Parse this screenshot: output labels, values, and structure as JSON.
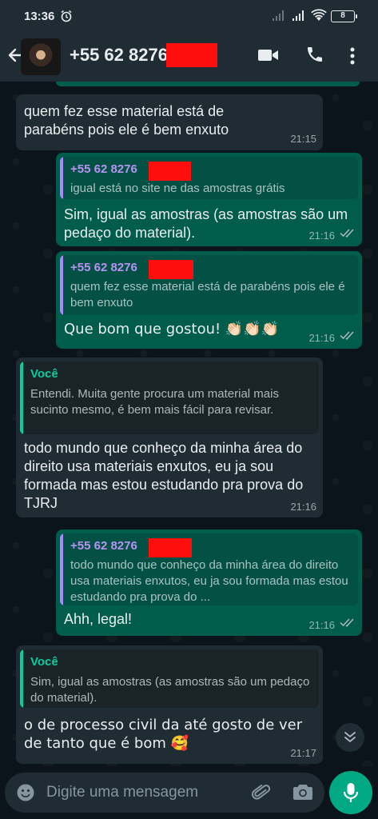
{
  "status_bar": {
    "time": "13:36",
    "battery": "8"
  },
  "header": {
    "contact_name": "+55 62 8276-"
  },
  "messages": [
    {
      "direction": "in",
      "text": "quem fez esse material está de parabéns pois ele é bem enxuto",
      "time": "21:15"
    },
    {
      "direction": "out",
      "quote": {
        "author": "+55 62 8276",
        "text": "igual está no site ne das amostras grátis"
      },
      "text": "Sim, igual as amostras (as amostras são um pedaço do material).",
      "time": "21:16",
      "status": "read"
    },
    {
      "direction": "out",
      "quote": {
        "author": "+55 62 8276",
        "text": "quem fez esse material está de parabéns pois ele é bem enxuto"
      },
      "text": "Que bom que gostou! 👏🏻👏🏻👏🏻",
      "time": "21:16",
      "status": "read"
    },
    {
      "direction": "in",
      "quote": {
        "author": "Você",
        "text": "Entendi. Muita gente procura um material mais sucinto mesmo, é bem mais fácil para revisar."
      },
      "text": "todo mundo que conheço da minha área do direito usa materiais enxutos, eu ja sou formada mas estou estudando pra prova do TJRJ",
      "time": "21:16"
    },
    {
      "direction": "out",
      "quote": {
        "author": "+55 62 8276",
        "text": "todo mundo que conheço da minha área do direito usa materiais enxutos, eu ja sou formada mas estou estudando pra prova do ..."
      },
      "text": "Ahh, legal!",
      "time": "21:16",
      "status": "read"
    },
    {
      "direction": "in",
      "quote": {
        "author": "Você",
        "text": "Sim, igual as amostras (as amostras são um pedaço do material)."
      },
      "text": "o de processo civil da até gosto de ver de tanto que é bom 🥰",
      "time": "21:17"
    }
  ],
  "composer": {
    "placeholder": "Digite uma mensagem"
  },
  "colors": {
    "header": "#1f2c34",
    "outgoing": "#005c4b",
    "incoming": "#202c33",
    "accent": "#00a884",
    "redaction": "#ff0e0e"
  },
  "icons": [
    "alarm-icon",
    "signal-icon",
    "wifi-icon",
    "battery-icon",
    "back-arrow-icon",
    "video-call-icon",
    "phone-icon",
    "more-vert-icon",
    "read-ticks-icon",
    "scroll-down-icon",
    "emoji-icon",
    "attach-icon",
    "camera-icon",
    "mic-icon"
  ]
}
